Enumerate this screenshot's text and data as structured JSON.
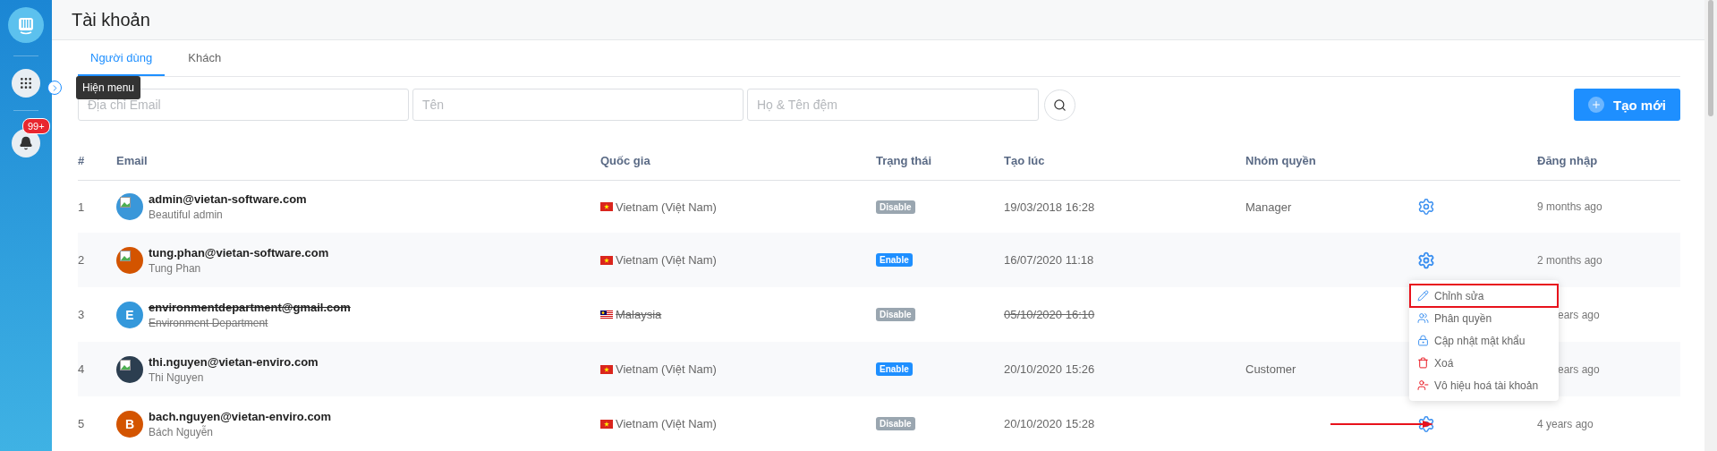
{
  "sidebar": {
    "notification_badge": "99+"
  },
  "tooltip": "Hiện menu",
  "page_title": "Tài khoản",
  "tabs": [
    {
      "label": "Người dùng",
      "selected": true
    },
    {
      "label": "Khách",
      "selected": false
    }
  ],
  "filters": [
    {
      "placeholder": "Địa chỉ Email"
    },
    {
      "placeholder": "Tên"
    },
    {
      "placeholder": "Họ & Tên đệm"
    }
  ],
  "create_button": "Tạo mới",
  "table": {
    "columns": [
      "#",
      "Email",
      "Quốc gia",
      "Trạng thái",
      "Tạo lúc",
      "Nhóm quyền",
      "Đăng nhập"
    ],
    "rows": [
      {
        "index": "1",
        "email": "admin@vietan-software.com",
        "name": "Beautiful admin",
        "avatar": {
          "kind": "image",
          "color": "#3a97d9"
        },
        "deleted": false,
        "flag": {
          "kind": "vn"
        },
        "country": "Vietnam (Việt Nam)",
        "status": "Disable",
        "enabled": false,
        "created": "19/03/2018 16:28",
        "group": "Manager",
        "login": "9 months ago",
        "covered": false,
        "pointed": false,
        "menu_open": false
      },
      {
        "index": "2",
        "email": "tung.phan@vietan-software.com",
        "name": "Tung Phan",
        "avatar": {
          "kind": "image",
          "color": "#d35400"
        },
        "deleted": false,
        "flag": {
          "kind": "vn"
        },
        "country": "Vietnam (Việt Nam)",
        "status": "Enable",
        "enabled": true,
        "created": "16/07/2020 11:18",
        "login": "2 months ago",
        "covered": false,
        "pointed": false,
        "menu_open": true
      },
      {
        "index": "3",
        "email": "environmentdepartment@gmail.com",
        "name": "Environment Department",
        "avatar": {
          "kind": "letter",
          "letter": "E",
          "color": "#3498db"
        },
        "deleted": true,
        "flag": {
          "kind": "my"
        },
        "country": "Malaysia",
        "status": "Disable",
        "enabled": false,
        "created": "05/10/2020 16:10",
        "login": "ears ago",
        "covered": true,
        "pointed": false,
        "menu_open": false
      },
      {
        "index": "4",
        "email": "thi.nguyen@vietan-enviro.com",
        "name": "Thi Nguyen",
        "avatar": {
          "kind": "image",
          "color": "#2c3e50"
        },
        "deleted": false,
        "flag": {
          "kind": "vn"
        },
        "country": "Vietnam (Việt Nam)",
        "status": "Enable",
        "enabled": true,
        "created": "20/10/2020 15:26",
        "group": "Customer",
        "login": "ears ago",
        "covered": true,
        "pointed": false,
        "menu_open": false
      },
      {
        "index": "5",
        "email": "bach.nguyen@vietan-enviro.com",
        "name": "Bách Nguyễn",
        "avatar": {
          "kind": "letter",
          "letter": "B",
          "color": "#d35400"
        },
        "deleted": false,
        "flag": {
          "kind": "vn"
        },
        "country": "Vietnam (Việt Nam)",
        "status": "Disable",
        "enabled": false,
        "created": "20/10/2020 15:28",
        "login": "4 years ago",
        "covered": false,
        "pointed": true,
        "menu_open": false
      }
    ]
  },
  "action_menu": {
    "items": [
      {
        "label": "Chỉnh sửa",
        "kind": "edit",
        "highlighted": true
      },
      {
        "label": "Phân quyền",
        "kind": "permissions",
        "highlighted": false
      },
      {
        "label": "Cập nhật mật khẩu",
        "kind": "password",
        "highlighted": false
      },
      {
        "label": "Xoá",
        "kind": "delete",
        "highlighted": false
      },
      {
        "label": "Vô hiệu hoá tài khoản",
        "kind": "deactivate",
        "highlighted": false
      }
    ]
  }
}
